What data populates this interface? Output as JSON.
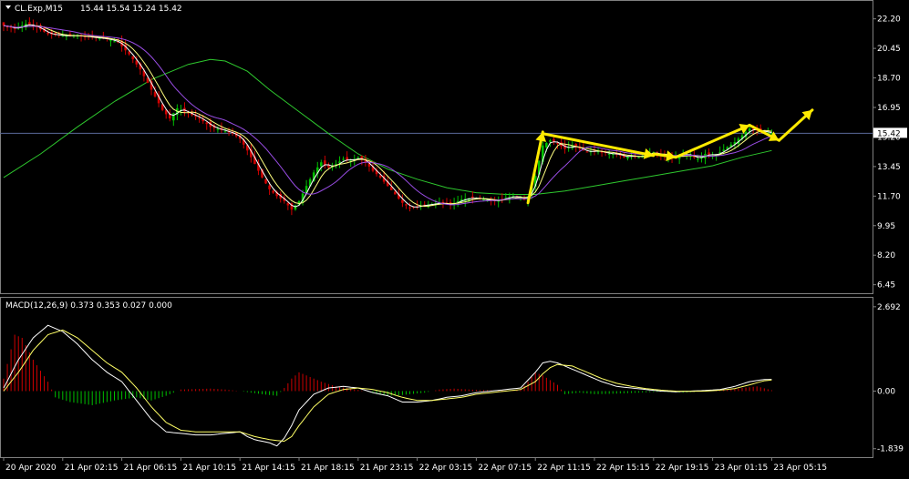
{
  "header": {
    "symbol_label": "CL.Exp,M15",
    "ohlc_label": "15.44 15.54 15.24 15.42",
    "macd_label": "MACD(12,26,9) 0.373 0.353 0.027 0.000"
  },
  "colors": {
    "background": "#000000",
    "bull": "#00c000",
    "bear": "#d00000",
    "ma_white": "#ffffff",
    "ma_yellow": "#ffff80",
    "ma_violet": "#9a4de6",
    "ma_green": "#2ec82e",
    "annotation": "#ffea00",
    "macd_signal": "#ffff66",
    "current_line": "#5a6a9a",
    "price_tag": "#ffffff"
  },
  "chart_data": [
    {
      "type": "candlestick",
      "panel": "price",
      "symbol": "CL.Exp",
      "timeframe": "M15",
      "ylim": [
        6.0,
        23.1
      ],
      "y_ticks": [
        "22.20",
        "20.45",
        "18.70",
        "16.95",
        "15.20",
        "13.45",
        "11.70",
        "9.95",
        "8.20",
        "6.45"
      ],
      "y_tick_values": [
        22.2,
        20.45,
        18.7,
        16.95,
        15.2,
        13.45,
        11.7,
        9.95,
        8.2,
        6.45
      ],
      "current_price": 15.42,
      "current_price_label": "15.42",
      "x_ticks": [
        "20 Apr 2020",
        "21 Apr 02:15",
        "21 Apr 06:15",
        "21 Apr 10:15",
        "21 Apr 14:15",
        "21 Apr 18:15",
        "21 Apr 23:15",
        "22 Apr 03:15",
        "22 Apr 07:15",
        "22 Apr 11:15",
        "22 Apr 15:15",
        "22 Apr 19:15",
        "23 Apr 01:15",
        "23 Apr 05:15"
      ],
      "x_tick_bars": [
        0,
        16,
        32,
        48,
        64,
        80,
        96,
        112,
        128,
        144,
        160,
        176,
        192,
        208
      ],
      "close_path": [
        [
          0,
          21.8
        ],
        [
          3,
          21.6
        ],
        [
          6,
          21.9
        ],
        [
          9,
          21.7
        ],
        [
          12,
          21.3
        ],
        [
          16,
          21.2
        ],
        [
          20,
          21.2
        ],
        [
          24,
          21.1
        ],
        [
          28,
          21.0
        ],
        [
          31,
          20.8
        ],
        [
          34,
          20.1
        ],
        [
          37,
          19.2
        ],
        [
          40,
          18.0
        ],
        [
          43,
          16.8
        ],
        [
          45,
          16.3
        ],
        [
          47,
          16.9
        ],
        [
          50,
          16.6
        ],
        [
          53,
          16.3
        ],
        [
          56,
          15.8
        ],
        [
          59,
          15.6
        ],
        [
          62,
          15.4
        ],
        [
          64,
          15.1
        ],
        [
          66,
          14.4
        ],
        [
          68,
          13.6
        ],
        [
          70,
          12.8
        ],
        [
          72,
          12.1
        ],
        [
          74,
          11.7
        ],
        [
          76,
          11.4
        ],
        [
          78,
          10.9
        ],
        [
          80,
          11.4
        ],
        [
          82,
          12.3
        ],
        [
          84,
          13.1
        ],
        [
          86,
          13.7
        ],
        [
          88,
          13.4
        ],
        [
          90,
          13.6
        ],
        [
          92,
          13.9
        ],
        [
          94,
          13.8
        ],
        [
          96,
          14.0
        ],
        [
          98,
          13.7
        ],
        [
          100,
          13.2
        ],
        [
          102,
          12.8
        ],
        [
          104,
          12.3
        ],
        [
          106,
          11.8
        ],
        [
          108,
          11.3
        ],
        [
          110,
          11.0
        ],
        [
          112,
          11.1
        ],
        [
          115,
          11.2
        ],
        [
          118,
          11.3
        ],
        [
          121,
          11.2
        ],
        [
          124,
          11.5
        ],
        [
          127,
          11.6
        ],
        [
          130,
          11.5
        ],
        [
          133,
          11.4
        ],
        [
          136,
          11.6
        ],
        [
          138,
          11.7
        ],
        [
          140,
          11.6
        ],
        [
          141,
          11.5
        ],
        [
          142,
          11.7
        ],
        [
          144,
          12.9
        ],
        [
          146,
          14.7
        ],
        [
          148,
          15.0
        ],
        [
          150,
          14.8
        ],
        [
          152,
          14.5
        ],
        [
          154,
          14.7
        ],
        [
          156,
          14.5
        ],
        [
          158,
          14.3
        ],
        [
          160,
          14.4
        ],
        [
          162,
          14.3
        ],
        [
          164,
          14.2
        ],
        [
          166,
          14.2
        ],
        [
          168,
          14.0
        ],
        [
          170,
          14.1
        ],
        [
          172,
          14.0
        ],
        [
          174,
          14.2
        ],
        [
          176,
          14.3
        ],
        [
          178,
          14.1
        ],
        [
          180,
          14.0
        ],
        [
          182,
          14.0
        ],
        [
          184,
          14.2
        ],
        [
          186,
          14.1
        ],
        [
          188,
          13.9
        ],
        [
          190,
          14.2
        ],
        [
          192,
          14.1
        ],
        [
          194,
          14.3
        ],
        [
          196,
          14.6
        ],
        [
          198,
          14.9
        ],
        [
          200,
          15.3
        ],
        [
          202,
          15.7
        ],
        [
          204,
          15.6
        ],
        [
          206,
          15.5
        ],
        [
          208,
          15.42
        ]
      ],
      "long_ma_path": [
        [
          0,
          12.8
        ],
        [
          10,
          14.2
        ],
        [
          20,
          15.8
        ],
        [
          30,
          17.3
        ],
        [
          40,
          18.6
        ],
        [
          50,
          19.5
        ],
        [
          56,
          19.8
        ],
        [
          60,
          19.7
        ],
        [
          66,
          19.1
        ],
        [
          72,
          18.0
        ],
        [
          80,
          16.7
        ],
        [
          88,
          15.4
        ],
        [
          96,
          14.2
        ],
        [
          104,
          13.3
        ],
        [
          112,
          12.7
        ],
        [
          120,
          12.2
        ],
        [
          128,
          11.9
        ],
        [
          136,
          11.8
        ],
        [
          144,
          11.8
        ],
        [
          152,
          12.0
        ],
        [
          160,
          12.3
        ],
        [
          168,
          12.6
        ],
        [
          176,
          12.9
        ],
        [
          184,
          13.2
        ],
        [
          192,
          13.5
        ],
        [
          200,
          14.0
        ],
        [
          208,
          14.4
        ]
      ],
      "annotations": {
        "arrows": [
          [
            [
              142,
              11.3
            ],
            [
              146,
              15.5
            ]
          ],
          [
            [
              146,
              15.4
            ],
            [
              176,
              14.1
            ]
          ],
          [
            [
              176,
              14.2
            ],
            [
              182,
              14.0
            ]
          ],
          [
            [
              182,
              14.0
            ],
            [
              202,
              15.9
            ]
          ],
          [
            [
              202,
              15.9
            ],
            [
              210,
              15.0
            ]
          ],
          [
            [
              210,
              15.0
            ],
            [
              219,
              16.8
            ]
          ]
        ]
      }
    },
    {
      "type": "macd",
      "panel": "macd",
      "name": "MACD(12,26,9)",
      "ylim": [
        -2.05,
        2.92
      ],
      "y_ticks": [
        "2.692",
        "0.00",
        "-1.839"
      ],
      "y_tick_values": [
        2.692,
        0.0,
        -1.839
      ],
      "values": [
        0.373,
        0.353,
        0.027,
        0.0
      ],
      "macd_path": [
        [
          0,
          0.1
        ],
        [
          4,
          1.0
        ],
        [
          8,
          1.7
        ],
        [
          12,
          2.1
        ],
        [
          16,
          1.9
        ],
        [
          20,
          1.5
        ],
        [
          24,
          1.0
        ],
        [
          28,
          0.6
        ],
        [
          32,
          0.3
        ],
        [
          36,
          -0.3
        ],
        [
          40,
          -0.9
        ],
        [
          44,
          -1.3
        ],
        [
          48,
          -1.35
        ],
        [
          52,
          -1.4
        ],
        [
          56,
          -1.4
        ],
        [
          60,
          -1.35
        ],
        [
          64,
          -1.3
        ],
        [
          66,
          -1.45
        ],
        [
          68,
          -1.55
        ],
        [
          70,
          -1.6
        ],
        [
          72,
          -1.65
        ],
        [
          74,
          -1.75
        ],
        [
          76,
          -1.5
        ],
        [
          78,
          -1.1
        ],
        [
          80,
          -0.6
        ],
        [
          84,
          -0.1
        ],
        [
          88,
          0.1
        ],
        [
          92,
          0.15
        ],
        [
          96,
          0.1
        ],
        [
          100,
          -0.05
        ],
        [
          104,
          -0.15
        ],
        [
          108,
          -0.35
        ],
        [
          112,
          -0.35
        ],
        [
          116,
          -0.3
        ],
        [
          120,
          -0.2
        ],
        [
          124,
          -0.15
        ],
        [
          128,
          -0.05
        ],
        [
          132,
          0.0
        ],
        [
          136,
          0.05
        ],
        [
          140,
          0.1
        ],
        [
          144,
          0.6
        ],
        [
          146,
          0.9
        ],
        [
          148,
          0.95
        ],
        [
          150,
          0.9
        ],
        [
          154,
          0.7
        ],
        [
          158,
          0.5
        ],
        [
          162,
          0.3
        ],
        [
          166,
          0.15
        ],
        [
          170,
          0.1
        ],
        [
          174,
          0.05
        ],
        [
          178,
          0.0
        ],
        [
          182,
          -0.02
        ],
        [
          186,
          0.0
        ],
        [
          190,
          0.02
        ],
        [
          194,
          0.05
        ],
        [
          198,
          0.15
        ],
        [
          202,
          0.3
        ],
        [
          206,
          0.37
        ],
        [
          208,
          0.373
        ]
      ],
      "signal_path": [
        [
          0,
          0.0
        ],
        [
          4,
          0.6
        ],
        [
          8,
          1.3
        ],
        [
          12,
          1.8
        ],
        [
          16,
          1.95
        ],
        [
          20,
          1.7
        ],
        [
          24,
          1.3
        ],
        [
          28,
          0.9
        ],
        [
          32,
          0.6
        ],
        [
          36,
          0.1
        ],
        [
          40,
          -0.5
        ],
        [
          44,
          -1.0
        ],
        [
          48,
          -1.25
        ],
        [
          52,
          -1.3
        ],
        [
          56,
          -1.3
        ],
        [
          60,
          -1.3
        ],
        [
          64,
          -1.3
        ],
        [
          68,
          -1.45
        ],
        [
          72,
          -1.55
        ],
        [
          76,
          -1.6
        ],
        [
          78,
          -1.45
        ],
        [
          80,
          -1.1
        ],
        [
          84,
          -0.5
        ],
        [
          88,
          -0.1
        ],
        [
          92,
          0.05
        ],
        [
          96,
          0.1
        ],
        [
          100,
          0.05
        ],
        [
          104,
          -0.05
        ],
        [
          108,
          -0.2
        ],
        [
          112,
          -0.3
        ],
        [
          116,
          -0.3
        ],
        [
          120,
          -0.25
        ],
        [
          124,
          -0.2
        ],
        [
          128,
          -0.1
        ],
        [
          132,
          -0.05
        ],
        [
          136,
          0.0
        ],
        [
          140,
          0.05
        ],
        [
          144,
          0.3
        ],
        [
          146,
          0.55
        ],
        [
          148,
          0.75
        ],
        [
          150,
          0.85
        ],
        [
          154,
          0.8
        ],
        [
          158,
          0.6
        ],
        [
          162,
          0.4
        ],
        [
          166,
          0.25
        ],
        [
          170,
          0.15
        ],
        [
          174,
          0.08
        ],
        [
          178,
          0.03
        ],
        [
          182,
          0.0
        ],
        [
          186,
          -0.01
        ],
        [
          190,
          0.0
        ],
        [
          194,
          0.03
        ],
        [
          198,
          0.08
        ],
        [
          202,
          0.2
        ],
        [
          206,
          0.33
        ],
        [
          208,
          0.353
        ]
      ],
      "histogram_path": [
        [
          0,
          0.4
        ],
        [
          3,
          1.8
        ],
        [
          5,
          1.7
        ],
        [
          8,
          1.0
        ],
        [
          12,
          0.3
        ],
        [
          14,
          -0.2
        ],
        [
          18,
          -0.35
        ],
        [
          24,
          -0.45
        ],
        [
          30,
          -0.3
        ],
        [
          36,
          -0.2
        ],
        [
          40,
          -0.3
        ],
        [
          44,
          -0.15
        ],
        [
          48,
          0.05
        ],
        [
          56,
          0.08
        ],
        [
          60,
          0.05
        ],
        [
          64,
          0.0
        ],
        [
          70,
          -0.1
        ],
        [
          74,
          -0.15
        ],
        [
          76,
          0.1
        ],
        [
          78,
          0.4
        ],
        [
          80,
          0.6
        ],
        [
          82,
          0.5
        ],
        [
          86,
          0.3
        ],
        [
          90,
          0.15
        ],
        [
          94,
          0.08
        ],
        [
          98,
          0.0
        ],
        [
          102,
          -0.12
        ],
        [
          106,
          -0.15
        ],
        [
          110,
          -0.1
        ],
        [
          114,
          -0.05
        ],
        [
          118,
          0.05
        ],
        [
          122,
          0.08
        ],
        [
          126,
          0.05
        ],
        [
          130,
          0.03
        ],
        [
          136,
          0.02
        ],
        [
          140,
          0.05
        ],
        [
          142,
          0.3
        ],
        [
          144,
          0.6
        ],
        [
          146,
          0.5
        ],
        [
          150,
          0.2
        ],
        [
          152,
          -0.1
        ],
        [
          156,
          -0.05
        ],
        [
          160,
          -0.1
        ],
        [
          166,
          -0.08
        ],
        [
          172,
          -0.05
        ],
        [
          178,
          -0.02
        ],
        [
          184,
          -0.05
        ],
        [
          190,
          0.0
        ],
        [
          196,
          0.05
        ],
        [
          200,
          0.1
        ],
        [
          204,
          0.15
        ],
        [
          208,
          0.027
        ]
      ]
    }
  ]
}
